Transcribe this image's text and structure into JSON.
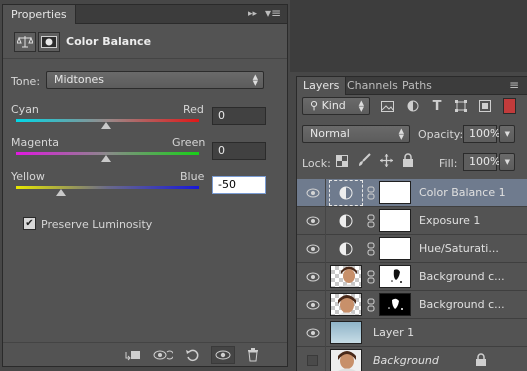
{
  "properties": {
    "tab_label": "Properties",
    "panel_title": "Color Balance",
    "tone": {
      "label": "Tone:",
      "value": "Midtones"
    },
    "sliders": [
      {
        "left": "Cyan",
        "right": "Red",
        "value": "0",
        "level": 0
      },
      {
        "left": "Magenta",
        "right": "Green",
        "value": "0",
        "level": 0
      },
      {
        "left": "Yellow",
        "right": "Blue",
        "value": "-50",
        "level": -50
      }
    ],
    "preserve_luminosity": {
      "label": "Preserve Luminosity",
      "checked": true
    },
    "footer_icons": [
      "clip-to-layer-icon",
      "view-previous-state-icon",
      "reset-icon",
      "visibility-eye-icon",
      "trash-icon"
    ]
  },
  "layers": {
    "tabs": [
      "Layers",
      "Channels",
      "Paths"
    ],
    "filter": {
      "value": "Kind"
    },
    "blend_mode": "Normal",
    "opacity": {
      "label": "Opacity:",
      "value": "100%"
    },
    "lock": {
      "label": "Lock:"
    },
    "fill": {
      "label": "Fill:",
      "value": "100%"
    },
    "rows": [
      {
        "name": "Color Balance 1",
        "visible": true,
        "type": "adjustment",
        "selected": true
      },
      {
        "name": "Exposure 1",
        "visible": true,
        "type": "adjustment",
        "selected": false
      },
      {
        "name": "Hue/Saturati...",
        "visible": true,
        "type": "adjustment",
        "selected": false
      },
      {
        "name": "Background c...",
        "visible": true,
        "type": "image",
        "selected": false
      },
      {
        "name": "Background c...",
        "visible": true,
        "type": "image",
        "selected": false
      },
      {
        "name": "Layer 1",
        "visible": true,
        "type": "gradient",
        "selected": false
      },
      {
        "name": "Background",
        "visible": false,
        "type": "background",
        "selected": false
      }
    ]
  },
  "colors": {
    "selected_row": "#6f7b8e",
    "panel": "#535353",
    "active_input_border": "#7a9cd3"
  }
}
